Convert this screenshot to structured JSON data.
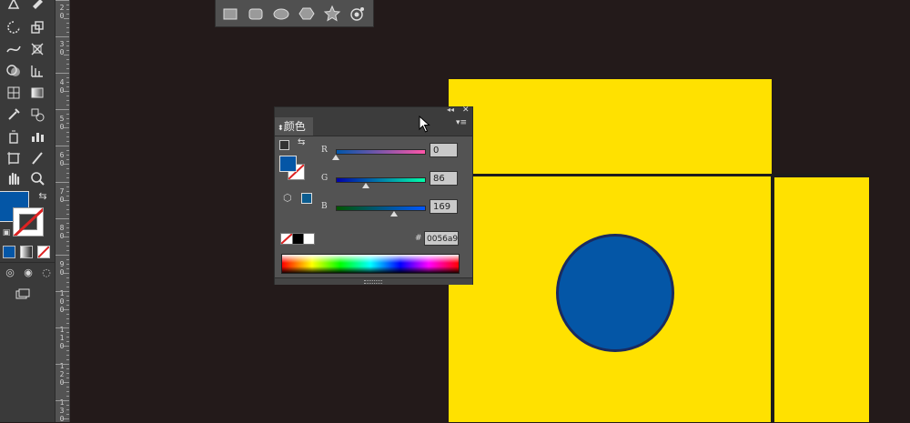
{
  "colors": {
    "fill": "#0456A6",
    "canvas": "#231A1A",
    "artboard": "#FFE100",
    "circle": "#0456A6",
    "circle_outline": "#1A2A5E"
  },
  "ruler": {
    "numbers": [
      {
        "value": "2\n0"
      },
      {
        "value": "3\n0"
      },
      {
        "value": "4\n0"
      },
      {
        "value": "5\n0"
      },
      {
        "value": "6\n0"
      },
      {
        "value": "7\n0"
      },
      {
        "value": "8\n0"
      },
      {
        "value": "9\n0"
      },
      {
        "value": "1\n0\n0"
      },
      {
        "value": "1\n1\n0"
      },
      {
        "value": "1\n2\n0"
      },
      {
        "value": "1\n3\n0"
      }
    ]
  },
  "shape_tools": [
    "rectangle-icon",
    "rounded-rectangle-icon",
    "ellipse-icon",
    "polygon-icon",
    "star-icon",
    "flare-icon"
  ],
  "panel": {
    "title": "颜色",
    "collapse_glyph": "◂◂",
    "close_glyph": "✕",
    "menu_glyph": "▾≡",
    "channels": [
      {
        "label": "R",
        "value": "0",
        "gradient": "linear-gradient(to right,#0056a9,#ff56a9)",
        "fraction": 0.0
      },
      {
        "label": "G",
        "value": "86",
        "gradient": "linear-gradient(to right,#0000a9,#00ffa9)",
        "fraction": 0.337
      },
      {
        "label": "B",
        "value": "169",
        "gradient": "linear-gradient(to right,#005600,#0056ff)",
        "fraction": 0.663
      }
    ],
    "hex_label": "#",
    "hex_value": "0056a9"
  }
}
